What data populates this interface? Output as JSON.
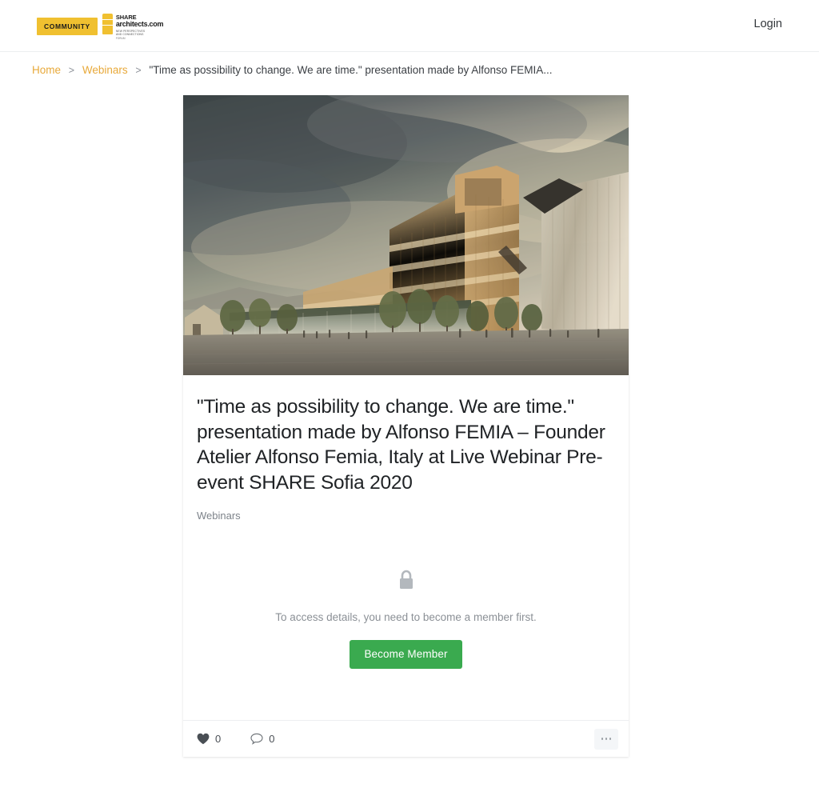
{
  "header": {
    "logo": {
      "community_label": "COMMUNITY",
      "share_line1": "SHARE",
      "share_line2": "architects.com",
      "share_sub1": "NEW PERSPECTIVES",
      "share_sub2": "AND CONNECTIONS",
      "share_sub3": "FORUM"
    },
    "login_label": "Login"
  },
  "breadcrumb": {
    "home": "Home",
    "webinars": "Webinars",
    "current": "\"Time as possibility to change. We are time.\" presentation made by Alfonso FEMIA...",
    "separator": ">"
  },
  "post": {
    "image_alt": "architectural-rendering-wooden-cantilevered-building-plaza",
    "title": "\"Time as possibility to change. We are time.\" presentation made by Alfonso FEMIA – Founder Atelier Alfonso Femia, Italy at Live Webinar Pre-event SHARE Sofia 2020",
    "category": "Webinars"
  },
  "locked": {
    "icon": "lock-icon",
    "message": "To access details, you need to become a member first.",
    "button_label": "Become Member"
  },
  "footer": {
    "like_icon": "heart-icon",
    "like_count": "0",
    "comment_icon": "comment-icon",
    "comment_count": "0",
    "more_icon": "ellipsis-icon"
  },
  "colors": {
    "brand_yellow": "#f0c030",
    "link_orange": "#e8a93a",
    "button_green": "#3aaa4f",
    "page_background": "#ffffff",
    "muted_text": "#8b9096"
  }
}
